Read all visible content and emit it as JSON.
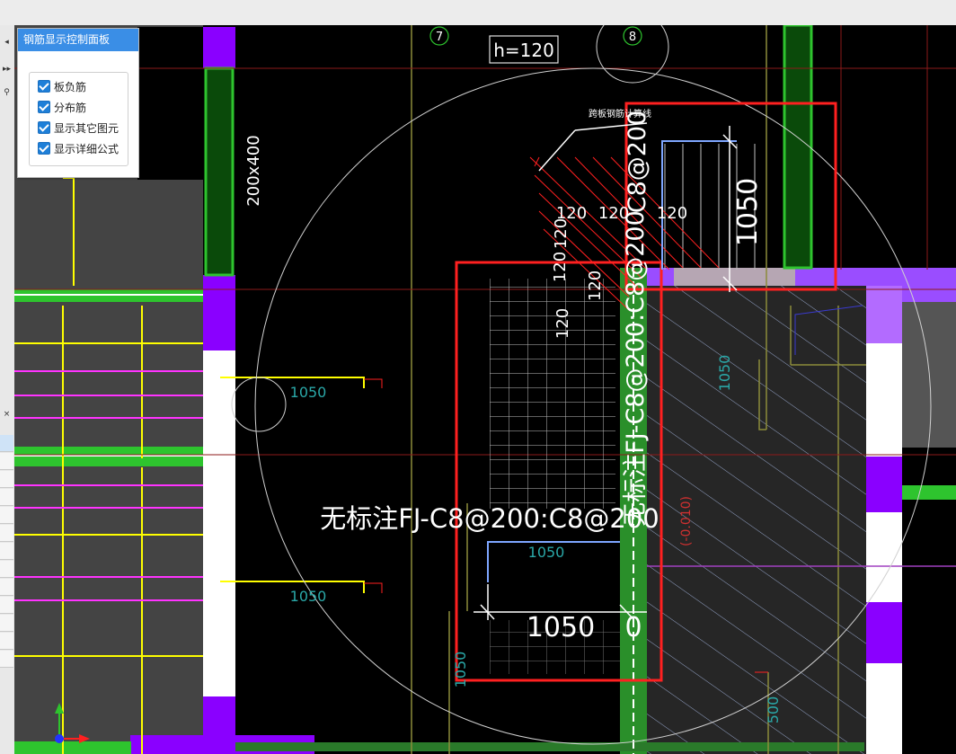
{
  "panel": {
    "title": "钢筋显示控制面板",
    "options": [
      {
        "label": "板负筋",
        "checked": true
      },
      {
        "label": "分布筋",
        "checked": true
      },
      {
        "label": "显示其它图元",
        "checked": true
      },
      {
        "label": "显示详细公式",
        "checked": true
      }
    ]
  },
  "drawing": {
    "axis_7": "7",
    "axis_8": "8",
    "slab_thickness": "h=120",
    "beam_size": "200x400",
    "main_annotation": "无标注FJ-C8@200:C8@200",
    "vertical_annotation_right": "无标注FJ-C8@200:C8@200",
    "vertical_annotation_top": "C8@200",
    "dim_1050": "1050",
    "dim_0": "0",
    "dim_120": "120",
    "dim_500": "500",
    "small_label": "跨板钢筋计算线",
    "level_label": "(-0.010)"
  },
  "colors": {
    "accent": "#3a8ee6",
    "green_beam": "#2ec42e",
    "purple_column": "#8a00ff",
    "yellow_line": "#ffff00",
    "magenta_line": "#ff33ff",
    "red_highlight": "#ff2020"
  }
}
